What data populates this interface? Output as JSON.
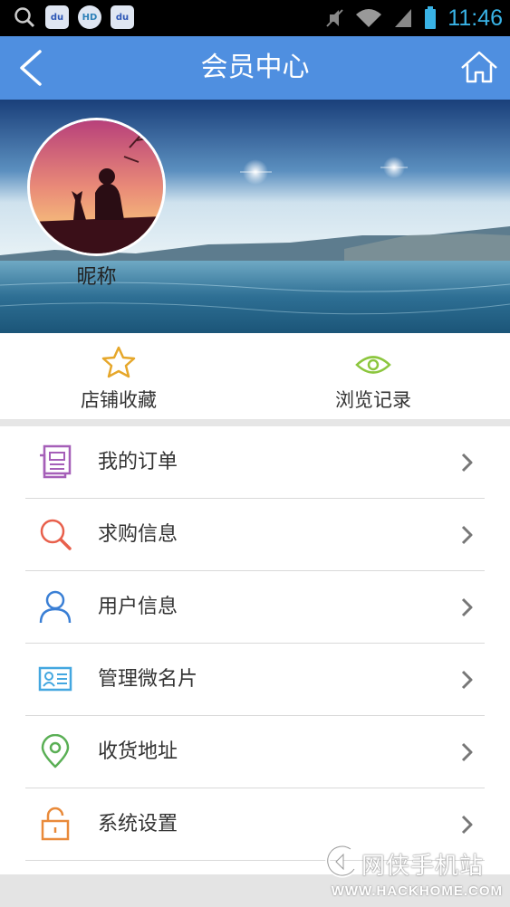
{
  "status_bar": {
    "time": "11:46",
    "app_icons": [
      "du",
      "HD",
      "du"
    ]
  },
  "header": {
    "title": "会员中心",
    "back_icon": "chevron-left-icon",
    "home_icon": "home-icon"
  },
  "profile": {
    "nickname": "昵称"
  },
  "quick_actions": [
    {
      "label": "店铺收藏",
      "icon": "star-icon",
      "color": "#e6a72a"
    },
    {
      "label": "浏览记录",
      "icon": "eye-icon",
      "color": "#8cc63e"
    }
  ],
  "menu": [
    {
      "label": "我的订单",
      "icon": "order-document-icon",
      "color": "#a55fb8"
    },
    {
      "label": "求购信息",
      "icon": "search-icon",
      "color": "#e8604c"
    },
    {
      "label": "用户信息",
      "icon": "user-icon",
      "color": "#3a7fd5"
    },
    {
      "label": "管理微名片",
      "icon": "business-card-icon",
      "color": "#43a7e0"
    },
    {
      "label": "收货地址",
      "icon": "location-pin-icon",
      "color": "#5aaf55"
    },
    {
      "label": "系统设置",
      "icon": "unlock-icon",
      "color": "#e98a3a"
    }
  ],
  "watermark": {
    "brand": "网侠手机站",
    "url": "WWW.HACKHOME.COM"
  },
  "colors": {
    "header": "#4f8fe0",
    "status_time": "#39b3e6",
    "divider": "#d9d9d9"
  }
}
